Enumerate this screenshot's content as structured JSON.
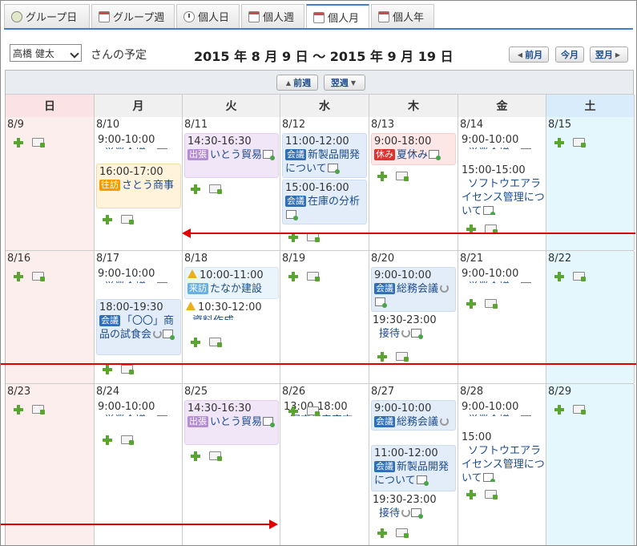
{
  "tabs": [
    {
      "label": "グループ日",
      "icon": "group-day-icon"
    },
    {
      "label": "グループ週",
      "icon": "group-week-icon"
    },
    {
      "label": "個人日",
      "icon": "clock-icon"
    },
    {
      "label": "個人週",
      "icon": "personal-week-icon"
    },
    {
      "label": "個人月",
      "icon": "calendar-month-icon",
      "active": true
    },
    {
      "label": "個人年",
      "icon": "calendar-year-icon"
    }
  ],
  "header": {
    "user_select": "高橋 健太",
    "user_suffix": "さんの予定",
    "range": "2015 年 8 月 9 日 ～ 2015 年 9 月 19 日",
    "prev_month": "前月",
    "this_month": "今月",
    "next_month": "翌月"
  },
  "weeknav": {
    "prev": "前週",
    "next": "翌週"
  },
  "weekdays": [
    "日",
    "月",
    "火",
    "水",
    "木",
    "金",
    "土"
  ],
  "colors": {
    "accent": "#3f7fc9",
    "link": "#1b4c8c",
    "sunday_bg": "#fdeeee",
    "saturday_bg": "#e3f7fc",
    "add_green": "#5aa532",
    "arrow_red": "#e00000"
  },
  "weeks": [
    {
      "days": [
        {
          "date": "8/9",
          "events": []
        },
        {
          "date": "8/10",
          "events": [
            {
              "time": "9:00-10:00",
              "title": "営業会議",
              "style": "plain",
              "repeat": true,
              "attach": true
            },
            {
              "time": "16:00-17:00",
              "tag": "往訪",
              "tag_color": "#f59b00",
              "title": "さとう商事",
              "style": "yellow"
            }
          ]
        },
        {
          "date": "8/11",
          "events": [
            {
              "time": "14:30-16:30",
              "tag": "出張",
              "tag_color": "#b48dd2",
              "title": "いとう貿易",
              "style": "purple",
              "attach": true
            }
          ]
        },
        {
          "date": "8/12",
          "events": [
            {
              "time": "11:00-12:00",
              "tag": "会議",
              "tag_color": "#2f6fb5",
              "title": "新製品開発について",
              "style": "blue",
              "attach": true
            },
            {
              "time": "15:00-16:00",
              "tag": "会議",
              "tag_color": "#2f6fb5",
              "title": "在庫の分析",
              "style": "blue",
              "attach": true
            }
          ]
        },
        {
          "date": "8/13",
          "events": [
            {
              "time": "9:00-18:00",
              "tag": "休み",
              "tag_color": "#e0322d",
              "title": "夏休み",
              "style": "pink",
              "attach": true
            }
          ]
        },
        {
          "date": "8/14",
          "events": [
            {
              "time": "9:00-10:00",
              "title": "営業会議",
              "style": "plain",
              "repeat": true,
              "attach": true
            },
            {
              "time": "15:00-15:00",
              "title": "ソフトウエアライセンス管理について",
              "style": "plain",
              "attach": true
            }
          ]
        },
        {
          "date": "8/15",
          "events": []
        }
      ]
    },
    {
      "days": [
        {
          "date": "8/16",
          "events": []
        },
        {
          "date": "8/17",
          "events": [
            {
              "time": "9:00-10:00",
              "title": "営業会議",
              "style": "plain",
              "repeat": true,
              "attach": true
            },
            {
              "time": "18:00-19:30",
              "tag": "会議",
              "tag_color": "#2f6fb5",
              "title": "「〇〇」商品の試食会",
              "style": "blue",
              "repeat": true,
              "attach": true
            }
          ]
        },
        {
          "date": "8/18",
          "events": [
            {
              "time": "10:00-11:00",
              "warn": true,
              "tag": "来訪",
              "tag_color": "#6ab0e0",
              "title": "たなか建設",
              "style": "lightblue"
            },
            {
              "time": "10:30-12:00",
              "warn": true,
              "title": "資料作成",
              "style": "plain"
            }
          ]
        },
        {
          "date": "8/19",
          "events": []
        },
        {
          "date": "8/20",
          "events": [
            {
              "time": "9:00-10:00",
              "tag": "会議",
              "tag_color": "#2f6fb5",
              "title": "総務会議",
              "style": "blue",
              "repeat": true,
              "attach": true
            },
            {
              "time": "19:30-23:00",
              "title": "接待",
              "style": "plain",
              "repeat": true,
              "attach": true
            }
          ]
        },
        {
          "date": "8/21",
          "events": [
            {
              "time": "9:00-10:00",
              "title": "営業会議",
              "style": "plain",
              "repeat": true,
              "attach": true
            }
          ]
        },
        {
          "date": "8/22",
          "events": []
        }
      ]
    },
    {
      "days": [
        {
          "date": "8/23",
          "events": []
        },
        {
          "date": "8/24",
          "events": [
            {
              "time": "9:00-10:00",
              "title": "営業会議",
              "style": "plain",
              "repeat": true,
              "attach": true
            }
          ]
        },
        {
          "date": "8/25",
          "events": [
            {
              "time": "14:30-16:30",
              "tag": "出張",
              "tag_color": "#b48dd2",
              "title": "いとう貿易",
              "style": "purple",
              "attach": true
            }
          ]
        },
        {
          "date": "8/26",
          "events": [
            {
              "time": "13:00-18:00",
              "title": "固定資産実査",
              "style": "plain"
            }
          ]
        },
        {
          "date": "8/27",
          "events": [
            {
              "time": "9:00-10:00",
              "tag": "会議",
              "tag_color": "#2f6fb5",
              "title": "総務会議",
              "style": "blue",
              "repeat": true,
              "attach": true
            },
            {
              "time": "11:00-12:00",
              "tag": "会議",
              "tag_color": "#2f6fb5",
              "title": "新製品開発について",
              "style": "blue",
              "attach": true
            },
            {
              "time": "19:30-23:00",
              "title": "接待",
              "style": "plain",
              "repeat": true,
              "attach": true
            }
          ]
        },
        {
          "date": "8/28",
          "events": [
            {
              "time": "9:00-10:00",
              "title": "営業会議",
              "style": "plain",
              "repeat": true,
              "attach": true
            },
            {
              "time": "15:00",
              "title": "ソフトウエアライセンス管理について",
              "style": "plain",
              "attach": true
            }
          ]
        },
        {
          "date": "8/29",
          "events": []
        }
      ]
    }
  ]
}
